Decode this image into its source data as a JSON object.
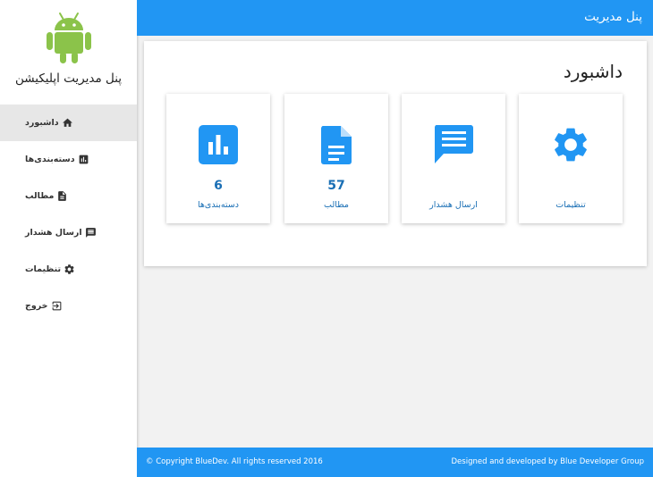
{
  "sidebar": {
    "app_title": "پنل مدیریت اپلیکیشن",
    "logo_icon": "android-icon",
    "items": [
      {
        "label": "داشبورد",
        "icon": "home-icon",
        "active": true
      },
      {
        "label": "دسته‌بندی‌ها",
        "icon": "bar-chart-icon",
        "active": false
      },
      {
        "label": "مطالب",
        "icon": "document-icon",
        "active": false
      },
      {
        "label": "ارسال هشدار",
        "icon": "message-icon",
        "active": false
      },
      {
        "label": "تنظیمات",
        "icon": "gear-icon",
        "active": false
      },
      {
        "label": "خروج",
        "icon": "exit-icon",
        "active": false
      }
    ]
  },
  "header": {
    "title": "پنل مدیریت"
  },
  "main": {
    "title": "داشبورد",
    "cards": [
      {
        "label": "دسته‌بندی‌ها",
        "count": "6",
        "icon": "bar-chart-icon"
      },
      {
        "label": "مطالب",
        "count": "57",
        "icon": "document-icon"
      },
      {
        "label": "ارسال هشدار",
        "count": "",
        "icon": "message-icon"
      },
      {
        "label": "تنظیمات",
        "count": "",
        "icon": "gear-icon"
      }
    ]
  },
  "footer": {
    "copyright": "© Copyright BlueDev. All rights reserved 2016",
    "credit": "Designed and developed by Blue Developer Group"
  },
  "colors": {
    "accent": "#2196f3",
    "android_green": "#8bc34a",
    "card_text": "#1a6fb5"
  }
}
